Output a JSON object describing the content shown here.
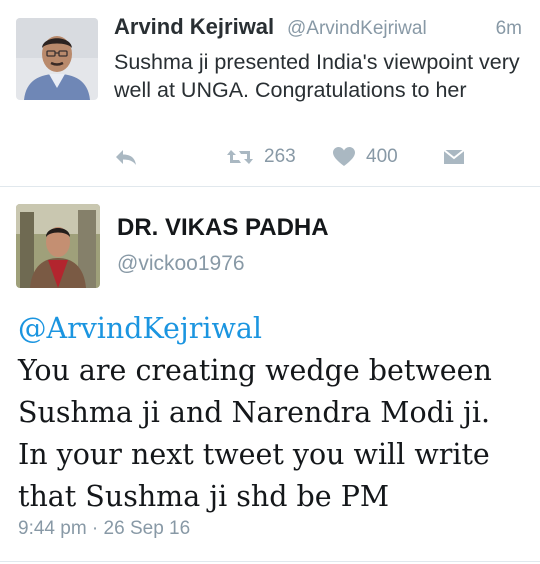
{
  "original_tweet": {
    "author_name": "Arvind Kejriwal",
    "author_handle": "@ArvindKejriwal",
    "time_ago": "6m",
    "text": "Sushma ji presented India's viewpoint very well at UNGA. Congratulations to her",
    "actions": {
      "reply_icon": "reply-icon",
      "retweet_icon": "retweet-icon",
      "retweet_count": "263",
      "like_icon": "heart-icon",
      "like_count": "400",
      "dm_icon": "envelope-icon"
    }
  },
  "reply_tweet": {
    "author_name": "DR. VIKAS PADHA",
    "author_handle": "@vickoo1976",
    "mention": "@ArvindKejriwal",
    "text": "You are creating wedge between Sushma ji and Narendra Modi ji. In your next tweet you will write that Sushma ji shd be PM",
    "timestamp": "9:44 pm · 26 Sep 16"
  },
  "colors": {
    "link_blue": "#1b95e0",
    "muted_gray": "#8899a6",
    "text_dark": "#14171a",
    "divider": "#e1e8ed"
  }
}
